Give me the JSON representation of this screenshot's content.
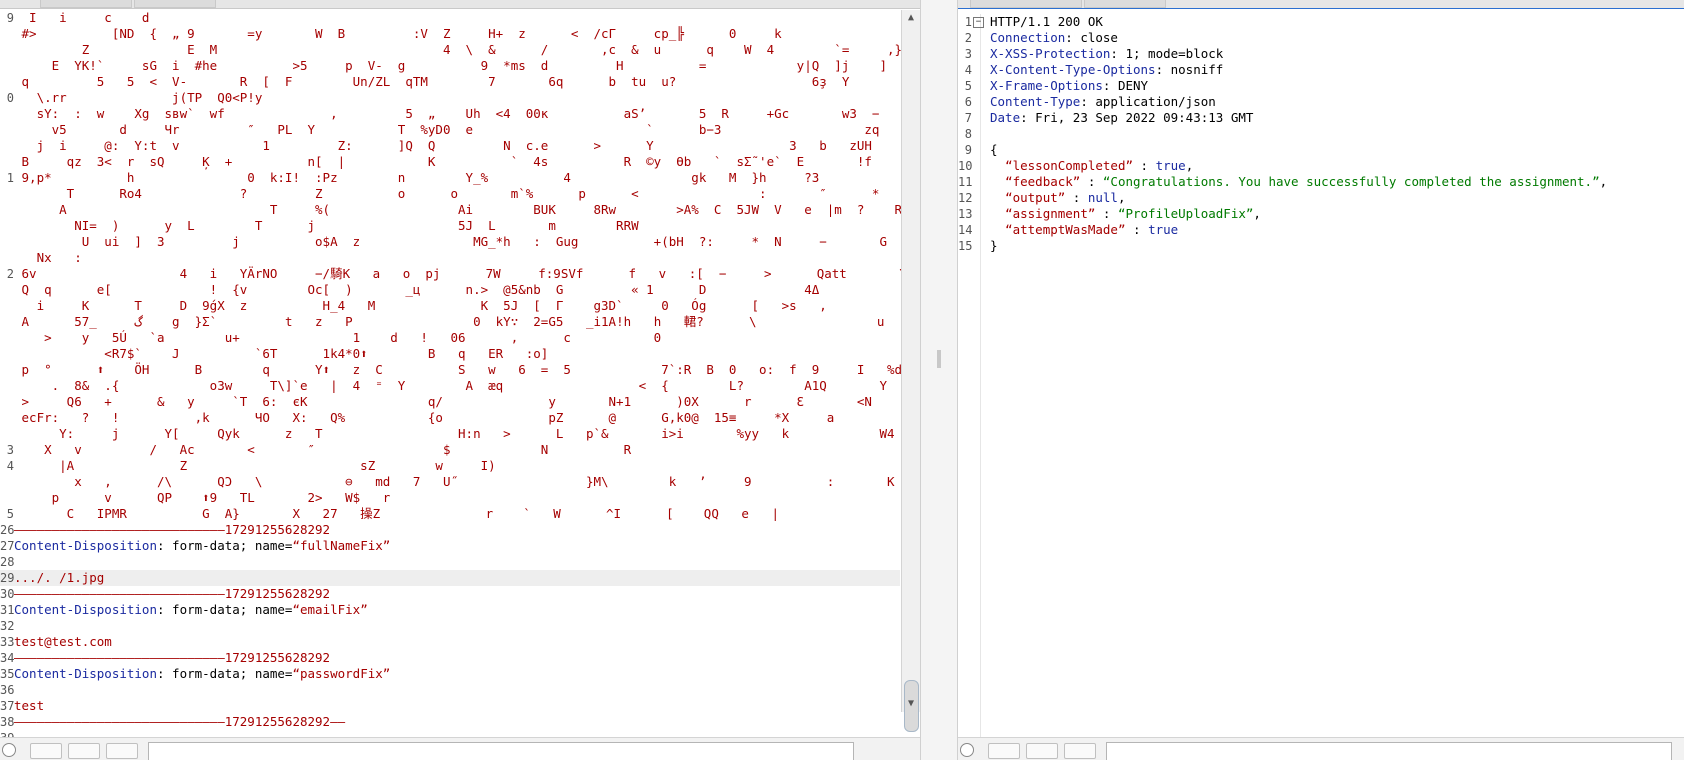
{
  "request": {
    "start_line_number": "9",
    "garbage_lines": [
      {
        "n": "9",
        "t": "  I   i     c    d"
      },
      {
        "n": "",
        "t": " #>          [ND  {  „ 9       =y       W  B         :V  Z     H+  z      <  /cГ     cp_╠      0     k                  ″c"
      },
      {
        "n": "",
        "t": "         Z             E  M                              4  \\  &      /       ,c  &  u      q    W  4        `=     ,}k"
      },
      {
        "n": "",
        "t": "     E  YK!`     sG  i  #he          >5     p  V-  g          9  *ms  d         H          =            y|Q  ]j    ]  7  jŽ      ’         /"
      },
      {
        "n": "",
        "t": " q         5   5  <  V-       R  [  F        Un/ZL  qTM        7       6q      b  tu  u?                  6ҙ  Y"
      },
      {
        "n": "0",
        "t": "   \\.rr              j(TP  Q0<P!y"
      },
      {
        "n": "",
        "t": "   sY:  :  w    Xg  sвw`  wf              ,         5  „    Uh  <4  00ĸ          aS’       5  R     +Gc       w3  −      :s     ,i  K  6  j  mU"
      },
      {
        "n": "",
        "t": "     v5       d     Чr         ″   PL  Y           T  %yD0  e                       `      b−3                   zq        E     KQ    P  −  !X  #"
      },
      {
        "n": "",
        "t": "   j  i     @:  Y:t  v           1         Z:      ]Q  Q         N  c.e      >      Y                  3   b   zUH       c   s    %b   @@技      J*"
      },
      {
        "n": "",
        "t": " B     qz  3<  r  sQ     Ķ  +          n[  |           K          `  4s          R  ©y  Өb   `  sΣ˜'e`  E       !f"
      },
      {
        "n": "1",
        "t": " 9,p*          h               0  k:I!  :Pz        n        Y_%          4                gk   M  }h     ?3             ib     6   o  }            o"
      },
      {
        "n": "",
        "t": "       T      Ro4             ?         Z          o      o       m`%      p      <                :       ″      *      h          X     ?y  n         `      <  ″"
      },
      {
        "n": "",
        "t": "      A                           T     %(                 Ai        BUK     8Rw        >A%  C  5JW  V   e  |m  ?    Ri  b        qD        G  E{     i"
      },
      {
        "n": "",
        "t": "        NI=  )      y  L        T      j                   5J  L       m        RRW"
      },
      {
        "n": "",
        "t": "         U  ui  ]  3         j          o$A  z               MG_*h   :  Gug          +(bH  ?:     *  N     −       G  1  7Ч  :          n4"
      },
      {
        "n": "",
        "t": "   Nx   :"
      },
      {
        "n": "2",
        "t": " 6v                   4   i   YÄrNO     −/騎K   a   o  pj      7W     f:9SVf      f   v   :[  −     >      Qatt       Y        0$ˆ        jƷ        Q$N"
      },
      {
        "n": "",
        "t": " Q  q      e[             !  {v        Oc[  )       _ц      n.>  @5&nb  G         « 1      D             4Δ                E_          `  dбI   I"
      },
      {
        "n": "",
        "t": "   i     K      T     D  9ǵX  z          H_4   M              K  5J  [  Г    g3D`     0   Óg      [   >s   ,               5      5CQÜ   0"
      },
      {
        "n": "",
        "t": " A      57_     گ    g  }Σ`         t   z   P                0  kY∵  2=G5   _i1A!h   h   輑?      \\                u   C   dS   =   Dk  `       /   b"
      },
      {
        "n": "",
        "t": "    >    y   5Ú   `a        u+               1    d   !   06      ,      c           0"
      },
      {
        "n": "",
        "t": "            <R7$`    J          `6T      1k4*0⬆        B   q   ER   :o]"
      },
      {
        "n": "",
        "t": " p  °      ⬆    ÖH      B        q      Y⬆   z  C          S   w   6  =  5            7`:R  B  0   o:  f  9     I   %d        k   F"
      },
      {
        "n": "",
        "t": "     .  8&  .{            o3w     T\\]`e   |  4  ⁼  Y        A  æq                  <  {        L?        A1Q       Y        PI                Hх`:"
      },
      {
        "n": "",
        "t": " >     Q6   +      &   y     `T  6:  єK                q/              y       N+1      )0X      r      Ɛ       <N                  4            }                5   <G"
      },
      {
        "n": "",
        "t": " ecFr:   ?   !          ,k      ЧO   X:   Q%           {o              pZ      @      G,k0@  15≡     *X     a"
      },
      {
        "n": "",
        "t": "      Y:     j      Y[     Qyk      z   T                  H:n   >      L   p`&       i>i       %yy   k            W4   R     8   S   u"
      },
      {
        "n": "3",
        "t": "    X   v         /   Ac       <       ″                 $            N          R"
      },
      {
        "n": "4",
        "t": "      |A              Z                       sZ        w     I)"
      },
      {
        "n": "",
        "t": "        x   ,      /\\      QƆ   \\           ⊖   md   7   U˝                 }M\\        k   ’     9          :       K       r        Wj   x   )   g      :/   p   C   o"
      },
      {
        "n": "",
        "t": "     p      v      QP    ⬆9   TL       2>   W$   r"
      },
      {
        "n": "5",
        "t": "       C   IPMR          G  A}       X   27   操Z              r    `   W      ^I      [    QQ   e   |"
      }
    ],
    "tail_lines": [
      {
        "n": "26",
        "type": "sep",
        "t": "————————————————————————————17291255628292"
      },
      {
        "n": "27",
        "type": "hdr",
        "k": "Content-Disposition",
        "v": ": form-data; name=",
        "q": "“fullNameFix”"
      },
      {
        "n": "28",
        "type": "blank",
        "t": ""
      },
      {
        "n": "29",
        "type": "val",
        "t": ".../. /1.jpg",
        "hl": true
      },
      {
        "n": "30",
        "type": "sep",
        "t": "————————————————————————————17291255628292"
      },
      {
        "n": "31",
        "type": "hdr",
        "k": "Content-Disposition",
        "v": ": form-data; name=",
        "q": "“emailFix”"
      },
      {
        "n": "32",
        "type": "blank",
        "t": ""
      },
      {
        "n": "33",
        "type": "val",
        "t": "test@test.com"
      },
      {
        "n": "34",
        "type": "sep",
        "t": "————————————————————————————17291255628292"
      },
      {
        "n": "35",
        "type": "hdr",
        "k": "Content-Disposition",
        "v": ": form-data; name=",
        "q": "“passwordFix”"
      },
      {
        "n": "36",
        "type": "blank",
        "t": ""
      },
      {
        "n": "37",
        "type": "val",
        "t": "test"
      },
      {
        "n": "38",
        "type": "sep",
        "t": "————————————————————————————17291255628292——"
      },
      {
        "n": "39",
        "type": "blank",
        "t": ""
      }
    ],
    "search_placeholder": "",
    "search_matches": ""
  },
  "response": {
    "lines": [
      {
        "n": "1",
        "parts": [
          {
            "c": "",
            "t": "HTTP/1.1 200 OK"
          }
        ],
        "fold": "−"
      },
      {
        "n": "2",
        "parts": [
          {
            "c": "key",
            "t": "Connection"
          },
          {
            "c": "",
            "t": ": close"
          }
        ]
      },
      {
        "n": "3",
        "parts": [
          {
            "c": "key",
            "t": "X-XSS-Protection"
          },
          {
            "c": "",
            "t": ": 1; mode=block"
          }
        ]
      },
      {
        "n": "4",
        "parts": [
          {
            "c": "key",
            "t": "X-Content-Type-Options"
          },
          {
            "c": "",
            "t": ": nosniff"
          }
        ]
      },
      {
        "n": "5",
        "parts": [
          {
            "c": "key",
            "t": "X-Frame-Options"
          },
          {
            "c": "",
            "t": ": DENY"
          }
        ]
      },
      {
        "n": "6",
        "parts": [
          {
            "c": "key",
            "t": "Content-Type"
          },
          {
            "c": "",
            "t": ": application/json"
          }
        ]
      },
      {
        "n": "7",
        "parts": [
          {
            "c": "key",
            "t": "Date"
          },
          {
            "c": "",
            "t": ": Fri, 23 Sep 2022 09:43:13 GMT"
          }
        ]
      },
      {
        "n": "8",
        "parts": [
          {
            "c": "",
            "t": ""
          }
        ]
      },
      {
        "n": "9",
        "parts": [
          {
            "c": "",
            "t": "{"
          }
        ]
      },
      {
        "n": "10",
        "parts": [
          {
            "c": "",
            "t": "  "
          },
          {
            "c": "jkey",
            "t": "“lessonCompleted”"
          },
          {
            "c": "",
            "t": " : "
          },
          {
            "c": "bool",
            "t": "true"
          },
          {
            "c": "",
            "t": ","
          }
        ]
      },
      {
        "n": "11",
        "parts": [
          {
            "c": "",
            "t": "  "
          },
          {
            "c": "jkey",
            "t": "“feedback”"
          },
          {
            "c": "",
            "t": " : "
          },
          {
            "c": "str",
            "t": "“Congratulations. You have successfully completed the assignment.”"
          },
          {
            "c": "",
            "t": ","
          }
        ]
      },
      {
        "n": "12",
        "parts": [
          {
            "c": "",
            "t": "  "
          },
          {
            "c": "jkey",
            "t": "“output”"
          },
          {
            "c": "",
            "t": " : "
          },
          {
            "c": "bool",
            "t": "null"
          },
          {
            "c": "",
            "t": ","
          }
        ]
      },
      {
        "n": "13",
        "parts": [
          {
            "c": "",
            "t": "  "
          },
          {
            "c": "jkey",
            "t": "“assignment”"
          },
          {
            "c": "",
            "t": " : "
          },
          {
            "c": "str",
            "t": "“ProfileUploadFix”"
          },
          {
            "c": "",
            "t": ","
          }
        ]
      },
      {
        "n": "14",
        "parts": [
          {
            "c": "",
            "t": "  "
          },
          {
            "c": "jkey",
            "t": "“attemptWasMade”"
          },
          {
            "c": "",
            "t": " : "
          },
          {
            "c": "bool",
            "t": "true"
          }
        ]
      },
      {
        "n": "15",
        "parts": [
          {
            "c": "",
            "t": "}"
          }
        ]
      }
    ],
    "search_placeholder": ""
  },
  "colors": {
    "garbage": "#a50000",
    "header_key": "#1a2aa0",
    "json_string": "#007a00",
    "json_key": "#a50000"
  }
}
